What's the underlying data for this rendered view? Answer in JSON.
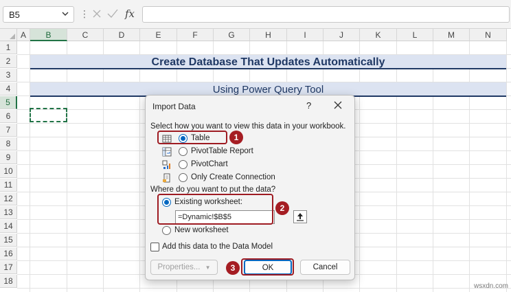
{
  "formula_bar": {
    "name_box": "B5",
    "fx_label": "fx",
    "formula_value": ""
  },
  "sheet": {
    "columns": [
      "A",
      "B",
      "C",
      "D",
      "E",
      "F",
      "G",
      "H",
      "I",
      "J",
      "K",
      "L",
      "M",
      "N"
    ],
    "rows": [
      "1",
      "2",
      "3",
      "4",
      "5",
      "6",
      "7",
      "8",
      "9",
      "10",
      "11",
      "12",
      "13",
      "14",
      "15",
      "16",
      "17",
      "18"
    ],
    "selected_column": "B",
    "selected_row": "5",
    "title": "Create Database That Updates Automatically",
    "subtitle": "Using Power Query Tool"
  },
  "dialog": {
    "title": "Import Data",
    "help": "?",
    "prompt_view": "Select how you want to view this data in your workbook.",
    "view_options": [
      {
        "label": "Table",
        "selected": true,
        "icon": "table-icon"
      },
      {
        "label": "PivotTable Report",
        "selected": false,
        "icon": "pivottable-icon"
      },
      {
        "label": "PivotChart",
        "selected": false,
        "icon": "pivotchart-icon"
      },
      {
        "label": "Only Create Connection",
        "selected": false,
        "icon": "connection-icon"
      }
    ],
    "prompt_where": "Where do you want to put the data?",
    "existing_label": "Existing worksheet:",
    "existing_selected": true,
    "reference_value": "=Dynamic!$B$5",
    "new_label": "New worksheet",
    "data_model_label": "Add this data to the Data Model",
    "data_model_checked": false,
    "properties_label": "Properties...",
    "ok_label": "OK",
    "cancel_label": "Cancel"
  },
  "annotations": {
    "badge1": "1",
    "badge2": "2",
    "badge3": "3",
    "color": "#a51d23"
  },
  "watermark": "wsxdn.com"
}
